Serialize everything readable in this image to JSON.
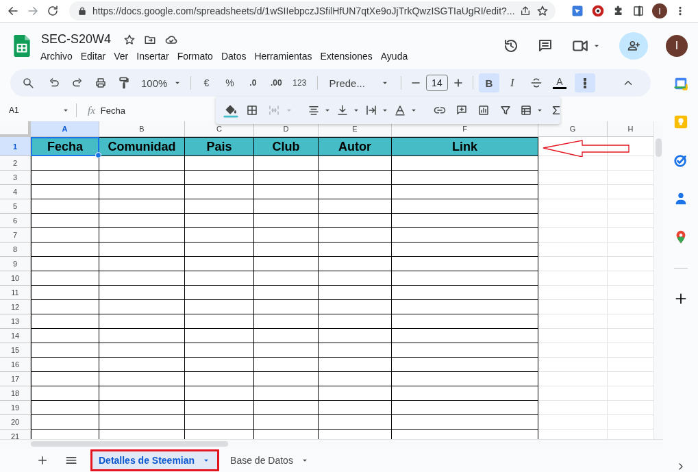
{
  "browser": {
    "url": "https://docs.google.com/spreadsheets/d/1wSIIebpczJSfilHfUN7qtXe9oJjTrkQwzISGTIaUgRI/edit?...",
    "avatar": "I"
  },
  "doc": {
    "title": "SEC-S20W4",
    "menu": [
      "Archivo",
      "Editar",
      "Ver",
      "Insertar",
      "Formato",
      "Datos",
      "Herramientas",
      "Extensiones",
      "Ayuda"
    ],
    "avatar": "I"
  },
  "toolbar": {
    "zoom": "100%",
    "format_buttons": [
      "€",
      "%",
      ".0",
      ".00",
      "123"
    ],
    "font": "Prede...",
    "font_size": "14",
    "style_buttons": [
      {
        "label": "B",
        "selected": true
      },
      {
        "label": "I",
        "selected": false
      }
    ],
    "text_color": "A",
    "overflow_open": true
  },
  "formula_bar": {
    "cell_ref": "A1",
    "fx": "fx",
    "value": "Fecha"
  },
  "grid": {
    "columns": [
      {
        "label": "A",
        "selected": true
      },
      {
        "label": "B",
        "selected": false
      },
      {
        "label": "C",
        "selected": false
      },
      {
        "label": "D",
        "selected": false
      },
      {
        "label": "E",
        "selected": false
      },
      {
        "label": "F",
        "selected": false
      },
      {
        "label": "G",
        "selected": false
      },
      {
        "label": "H",
        "selected": false
      }
    ],
    "rows": [
      {
        "label": "1",
        "selected": true,
        "cells": [
          "Fecha",
          "Comunidad",
          "Pais",
          "Club",
          "Autor",
          "Link"
        ]
      },
      {
        "label": "2",
        "selected": false
      },
      {
        "label": "3",
        "selected": false
      },
      {
        "label": "4",
        "selected": false
      },
      {
        "label": "5",
        "selected": false
      },
      {
        "label": "6",
        "selected": false
      },
      {
        "label": "7",
        "selected": false
      },
      {
        "label": "8",
        "selected": false
      },
      {
        "label": "9",
        "selected": false
      },
      {
        "label": "10",
        "selected": false
      },
      {
        "label": "11",
        "selected": false
      },
      {
        "label": "12",
        "selected": false
      },
      {
        "label": "13",
        "selected": false
      },
      {
        "label": "14",
        "selected": false
      },
      {
        "label": "15",
        "selected": false
      },
      {
        "label": "16",
        "selected": false
      },
      {
        "label": "17",
        "selected": false
      },
      {
        "label": "18",
        "selected": false
      },
      {
        "label": "19",
        "selected": false
      },
      {
        "label": "20",
        "selected": false
      },
      {
        "label": "21",
        "selected": false
      }
    ]
  },
  "sheets": [
    {
      "label": "Detalles de Steemian",
      "selected": true
    },
    {
      "label": "Base de Datos",
      "selected": false
    }
  ]
}
